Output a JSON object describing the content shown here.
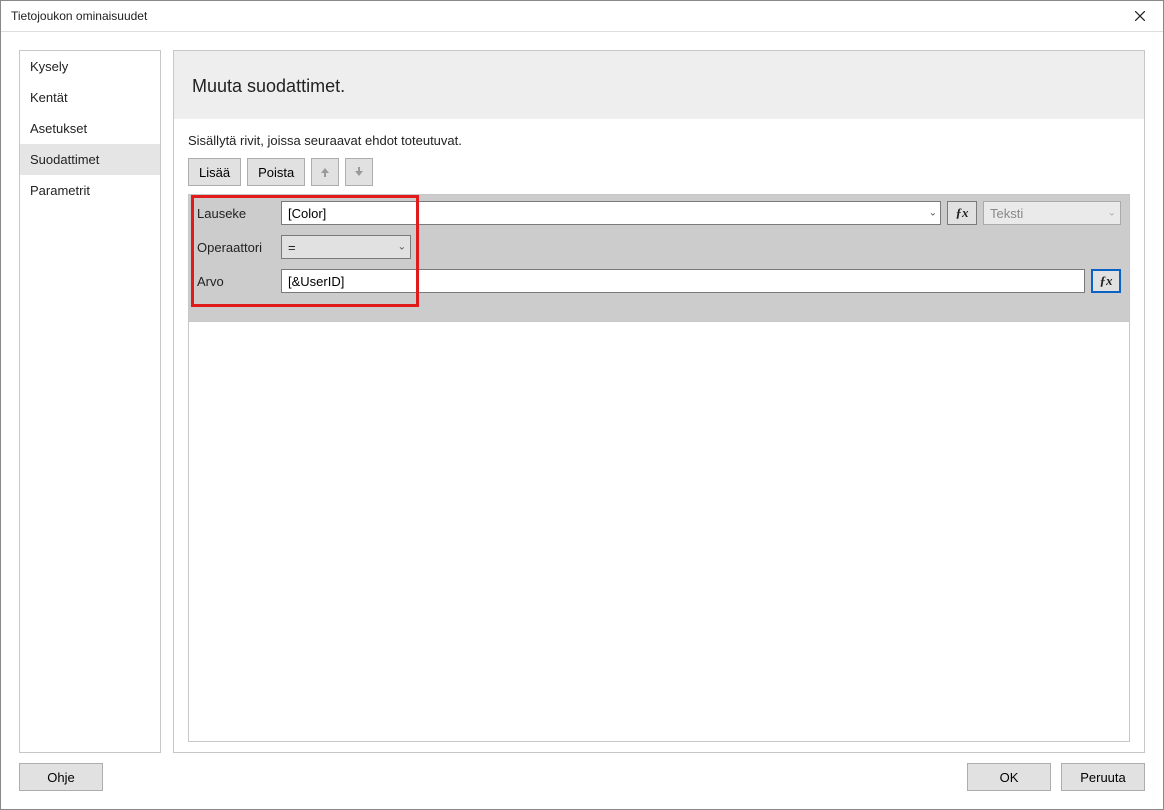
{
  "title": "Tietojoukon ominaisuudet",
  "sidebar": {
    "items": [
      {
        "label": "Kysely"
      },
      {
        "label": "Kentät"
      },
      {
        "label": "Asetukset"
      },
      {
        "label": "Suodattimet",
        "selected": true
      },
      {
        "label": "Parametrit"
      }
    ]
  },
  "panel": {
    "heading": "Muuta suodattimet.",
    "instruction": "Sisällytä rivit, joissa seuraavat ehdot toteutuvat."
  },
  "toolbar": {
    "add": "Lisää",
    "remove": "Poista"
  },
  "filter": {
    "expr_label": "Lauseke",
    "expr_value": "[Color]",
    "type_value": "Teksti",
    "op_label": "Operaattori",
    "op_value": "=",
    "val_label": "Arvo",
    "val_value": "[&UserID]"
  },
  "footer": {
    "help": "Ohje",
    "ok": "OK",
    "cancel": "Peruuta"
  },
  "icons": {
    "fx": "ƒx"
  }
}
